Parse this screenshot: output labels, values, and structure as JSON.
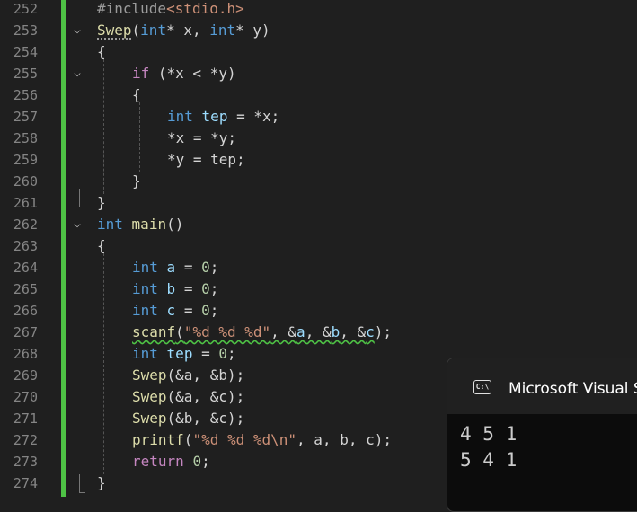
{
  "editor": {
    "line_numbers": [
      "252",
      "253",
      "254",
      "255",
      "256",
      "257",
      "258",
      "259",
      "260",
      "261",
      "262",
      "263",
      "264",
      "265",
      "266",
      "267",
      "268",
      "269",
      "270",
      "271",
      "272",
      "273",
      "274"
    ],
    "fold_icon": "chevron-down-icon",
    "fold_glyph": "⌵",
    "lines": {
      "l252": {
        "directive": "#include",
        "header": "<stdio.h>"
      },
      "l253": {
        "fn_name": "Swep",
        "p1": "(",
        "t1": "int",
        "s1": "* x, ",
        "t2": "int",
        "s2": "* y)"
      },
      "l254": {
        "text": "{"
      },
      "l255": {
        "kw": "if",
        "rest": " (*x < *y)"
      },
      "l256": {
        "text": "{"
      },
      "l257": {
        "type": "int",
        "var": "tep",
        "rest": " = *x;"
      },
      "l258": {
        "text": "*x = *y;"
      },
      "l259": {
        "text": "*y = tep;"
      },
      "l260": {
        "text": "}"
      },
      "l261": {
        "text": "}"
      },
      "l262": {
        "type": "int",
        "fn_name": "main",
        "rest": "()"
      },
      "l263": {
        "text": "{"
      },
      "l264": {
        "type": "int",
        "var": "a",
        "mid": " = ",
        "num": "0",
        "end": ";"
      },
      "l265": {
        "type": "int",
        "var": "b",
        "mid": " = ",
        "num": "0",
        "end": ";"
      },
      "l266": {
        "type": "int",
        "var": "c",
        "mid": " = ",
        "num": "0",
        "end": ";"
      },
      "l267": {
        "fn_name": "scanf",
        "open": "(",
        "str": "\"%d %d %d\"",
        "c1": ", &",
        "v1": "a",
        "c2": ", &",
        "v2": "b",
        "c3": ", &",
        "v3": "c",
        "close": ");"
      },
      "l268": {
        "type": "int",
        "var": "tep",
        "mid": " = ",
        "num": "0",
        "end": ";"
      },
      "l269": {
        "fn_name": "Swep",
        "rest": "(&a, &b);"
      },
      "l270": {
        "fn_name": "Swep",
        "rest": "(&a, &c);"
      },
      "l271": {
        "fn_name": "Swep",
        "rest": "(&b, &c);"
      },
      "l272": {
        "fn_name": "printf",
        "open": "(",
        "str": "\"%d %d %d\\n\"",
        "rest": ", a, b, c);"
      },
      "l273": {
        "kw": "return",
        "sp": " ",
        "num": "0",
        "end": ";"
      },
      "l274": {
        "text": "}"
      }
    }
  },
  "console": {
    "icon": "console-icon",
    "icon_glyph": "C:\\",
    "title": "Microsoft Visual S",
    "output": [
      "4 5 1",
      "5 4 1"
    ]
  },
  "colors": {
    "background": "#1f1f1f",
    "change_bar": "#4ec245",
    "keyword": "#569cd6",
    "control": "#c586c0",
    "function": "#dcdcaa",
    "variable": "#9cdcfe",
    "number": "#b5cea8",
    "string": "#ce9178"
  }
}
